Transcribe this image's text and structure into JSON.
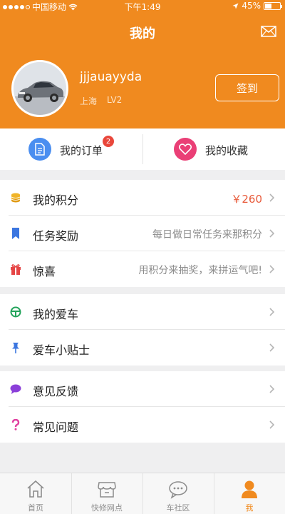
{
  "status_bar": {
    "carrier": "中国移动",
    "time": "下午1:49",
    "battery": "45%"
  },
  "header": {
    "title": "我的",
    "user": {
      "name": "jjjauayyda",
      "location": "上海",
      "level": "LV2"
    },
    "checkin_label": "签到"
  },
  "quick_actions": {
    "orders": {
      "label": "我的订单",
      "badge": "2"
    },
    "favorites": {
      "label": "我的收藏"
    }
  },
  "menu": {
    "points": {
      "label": "我的积分",
      "value": "￥260"
    },
    "tasks": {
      "label": "任务奖励",
      "value": "每日做日常任务来那积分"
    },
    "surprise": {
      "label": "惊喜",
      "value": "用积分来抽奖，来拼运气吧!"
    },
    "my_car": {
      "label": "我的爱车"
    },
    "car_tips": {
      "label": "爱车小贴士"
    },
    "feedback": {
      "label": "意见反馈"
    },
    "faq": {
      "label": "常见问题"
    }
  },
  "tabbar": {
    "home": "首页",
    "repair": "快修网点",
    "community": "车社区",
    "me": "我"
  },
  "colors": {
    "brand": "#f08a1f",
    "orders_icon": "#4a8ef0",
    "favorites_icon": "#ea3f76",
    "badge": "#e9473b"
  }
}
